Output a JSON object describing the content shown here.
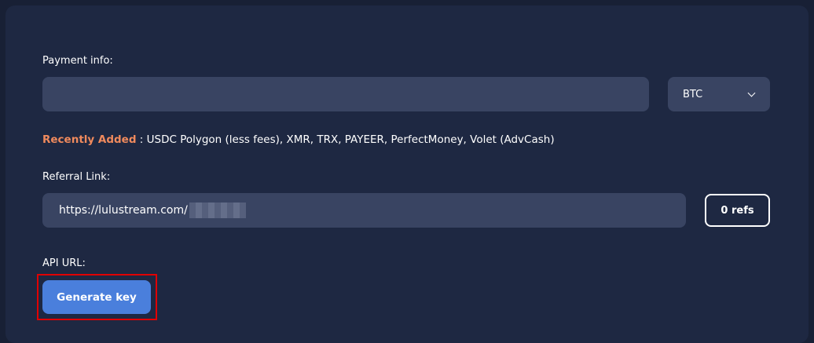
{
  "payment": {
    "label": "Payment info:",
    "input_value": "",
    "currency_selected": "BTC"
  },
  "recent": {
    "highlight": "Recently Added",
    "text": " : USDC Polygon (less fees), XMR, TRX, PAYEER, PerfectMoney, Volet (AdvCash)"
  },
  "referral": {
    "label": "Referral Link:",
    "link_prefix": "https://lulustream.com/",
    "refs_label": "0 refs"
  },
  "api": {
    "label": "API URL:",
    "generate_label": "Generate key"
  },
  "colors": {
    "background": "#182035",
    "panel": "#1e2842",
    "field": "#394462",
    "accent_orange": "#f08a5d",
    "primary_button": "#4a7fdc",
    "annotation_red": "#e00000"
  },
  "icons": {
    "select_arrow": "chevron-down-icon"
  }
}
